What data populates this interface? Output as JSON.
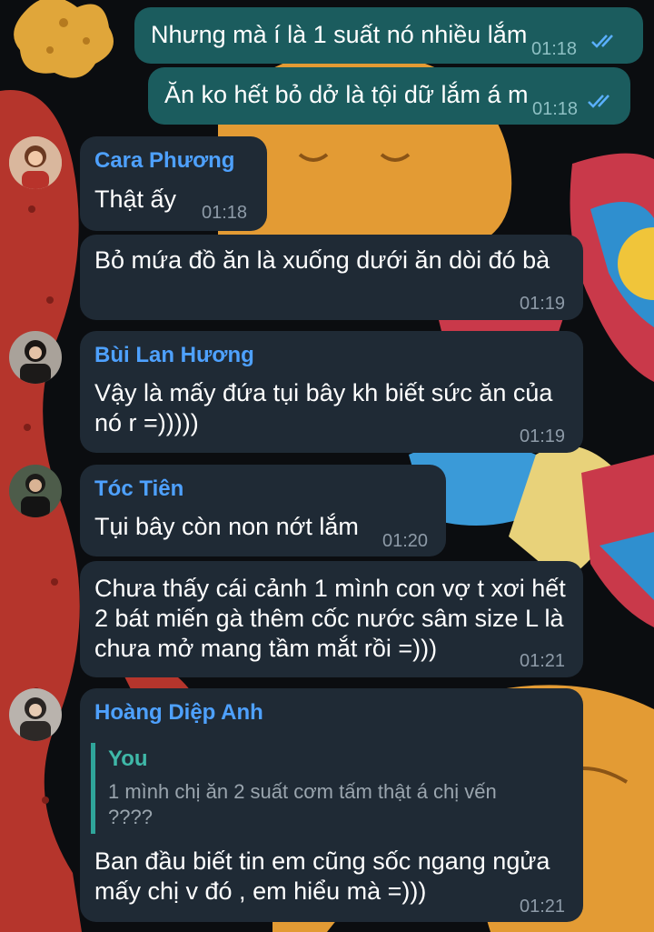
{
  "colors": {
    "incoming_bubble": "#1f2a35",
    "outgoing_bubble": "#1b5c5e",
    "sender_name": "#4ea1ff",
    "reply_accent": "#2fa59a",
    "timestamp": "#8e9ba8",
    "read_ticks": "#5ab0ff"
  },
  "messages": [
    {
      "text": "Nhưng mà í là 1 suất nó nhiều lắm",
      "time": "01:18",
      "status_icon": "double-check-icon"
    },
    {
      "text": "Ăn ko hết bỏ dở là tội dữ lắm á m",
      "time": "01:18",
      "status_icon": "double-check-icon"
    },
    {
      "sender": "Cara Phương",
      "text": "Thật ấy",
      "time": "01:18",
      "sender_color": "#4ea1ff"
    },
    {
      "text": "Bỏ mứa đồ ăn là xuống dưới ăn dòi đó bà",
      "time": "01:19"
    },
    {
      "sender": "Bùi Lan Hương",
      "text": "Vậy là mấy đứa tụi bây kh biết sức ăn của nó r =)))))",
      "time": "01:19",
      "sender_color": "#4ea1ff"
    },
    {
      "sender": "Tóc Tiên",
      "text": "Tụi bây còn non nớt lắm",
      "time": "01:20",
      "sender_color": "#4ea1ff"
    },
    {
      "text": "Chưa thấy cái cảnh 1 mình con vợ t xơi hết 2 bát miến gà thêm cốc nước sâm size L là chưa mở mang tầm mắt rồi =)))",
      "time": "01:21"
    },
    {
      "sender": "Hoàng Diệp Anh",
      "sender_color": "#4ea1ff",
      "reply_to": {
        "name": "You",
        "text": "1 mình chị ăn 2 suất cơm tấm thật á chị vến  ????"
      },
      "text": "Ban đầu biết tin em cũng sốc ngang ngửa mấy chị v đó , em hiểu mà =)))",
      "time": "01:21"
    }
  ]
}
